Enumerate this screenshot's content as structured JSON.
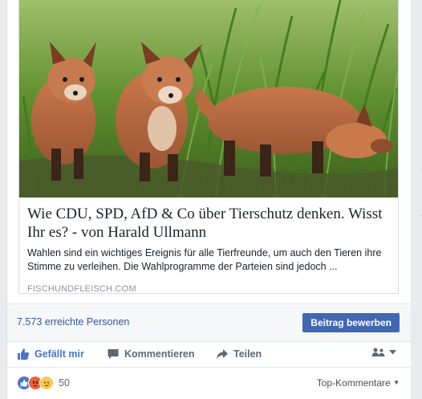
{
  "post": {
    "link_card": {
      "image_icon": "fox-cubs-photo",
      "title": "Wie CDU, SPD, AfD & Co über Tierschutz denken. Wisst Ihr es? - von Harald Ullmann",
      "description": "Wahlen sind ein wichtiges Ereignis für alle Tierfreunde, um auch den Tieren ihre Stimme zu verleihen. Die Wahlprogramme der Parteien sind jedoch ...",
      "domain": "FISCHUNDFLEISCH.COM"
    },
    "stats": {
      "reach_text": "7.573 erreichte Personen",
      "promote_label": "Beitrag bewerben"
    },
    "actions": {
      "like_label": "Gefällt mir",
      "comment_label": "Kommentieren",
      "share_label": "Teilen",
      "audience_icon": "friends-audience-icon"
    },
    "reactions": {
      "icons": [
        "like-reaction-icon",
        "angry-reaction-icon",
        "sad-reaction-icon"
      ],
      "count": "50",
      "sort_label": "Top-Kommentare"
    },
    "colors": {
      "link_blue": "#365899",
      "button_blue": "#4267b2",
      "like_blue": "#4b74c5",
      "angry_orange": "#f0613a",
      "sad_yellow": "#f7c94b"
    }
  }
}
